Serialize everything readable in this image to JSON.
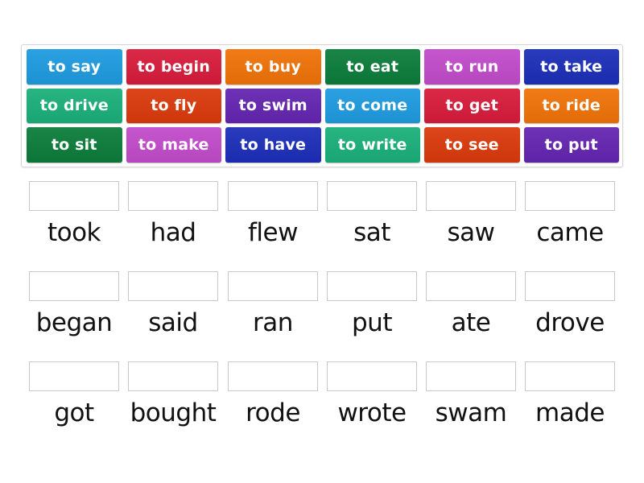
{
  "tiles": [
    {
      "label": "to say",
      "color": "#1e9be0"
    },
    {
      "label": "to begin",
      "color": "#d81b3c"
    },
    {
      "label": "to buy",
      "color": "#f07308"
    },
    {
      "label": "to eat",
      "color": "#0b7d3a"
    },
    {
      "label": "to run",
      "color": "#c24bcb"
    },
    {
      "label": "to take",
      "color": "#1c2fb8"
    },
    {
      "label": "to drive",
      "color": "#1bb07a"
    },
    {
      "label": "to fly",
      "color": "#da3a0c"
    },
    {
      "label": "to swim",
      "color": "#6425b0"
    },
    {
      "label": "to come",
      "color": "#1e9be0"
    },
    {
      "label": "to get",
      "color": "#d81b3c"
    },
    {
      "label": "to ride",
      "color": "#f07308"
    },
    {
      "label": "to sit",
      "color": "#0b7d3a"
    },
    {
      "label": "to make",
      "color": "#c24bcb"
    },
    {
      "label": "to have",
      "color": "#1c2fb8"
    },
    {
      "label": "to write",
      "color": "#1bb07a"
    },
    {
      "label": "to see",
      "color": "#da3a0c"
    },
    {
      "label": "to put",
      "color": "#6425b0"
    }
  ],
  "targets": [
    {
      "word": "took",
      "value": ""
    },
    {
      "word": "had",
      "value": ""
    },
    {
      "word": "flew",
      "value": ""
    },
    {
      "word": "sat",
      "value": ""
    },
    {
      "word": "saw",
      "value": ""
    },
    {
      "word": "came",
      "value": ""
    },
    {
      "word": "began",
      "value": ""
    },
    {
      "word": "said",
      "value": ""
    },
    {
      "word": "ran",
      "value": ""
    },
    {
      "word": "put",
      "value": ""
    },
    {
      "word": "ate",
      "value": ""
    },
    {
      "word": "drove",
      "value": ""
    },
    {
      "word": "got",
      "value": ""
    },
    {
      "word": "bought",
      "value": ""
    },
    {
      "word": "rode",
      "value": ""
    },
    {
      "word": "wrote",
      "value": ""
    },
    {
      "word": "swam",
      "value": ""
    },
    {
      "word": "made",
      "value": ""
    }
  ]
}
